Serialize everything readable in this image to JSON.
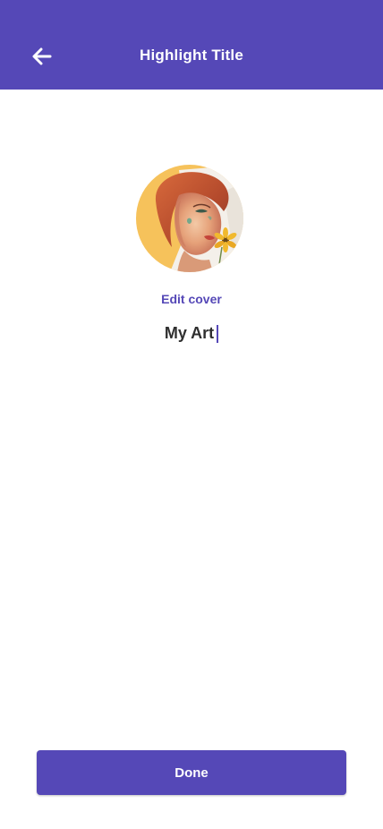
{
  "header": {
    "title": "Highlight Title",
    "back_icon": "arrow-left-icon",
    "background_color": "#5548b7"
  },
  "cover": {
    "image": "woman-portrait-painting",
    "edit_label": "Edit cover"
  },
  "title_input": {
    "value": "My Art"
  },
  "actions": {
    "done_label": "Done"
  },
  "colors": {
    "accent": "#5548b7",
    "text": "#2f2f2f"
  }
}
